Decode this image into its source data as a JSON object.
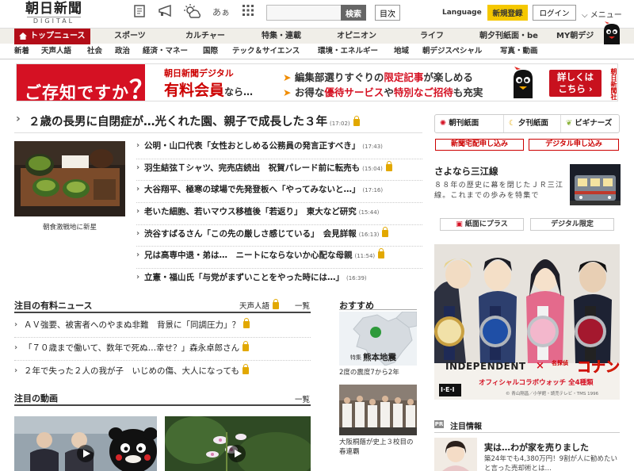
{
  "header": {
    "logo_main": "朝日新聞",
    "logo_sub": "DIGITAL",
    "search_placeholder": "",
    "search_button": "検索",
    "index_button": "目次",
    "language": "Language",
    "signup": "新規登録",
    "login": "ログイン",
    "menu": "メニュー",
    "font_size_glyph": "あぁ"
  },
  "nav_main": [
    "トップニュース",
    "スポーツ",
    "カルチャー",
    "特集・連載",
    "オピニオン",
    "ライフ",
    "朝夕刊紙面・be",
    "MY朝デジ"
  ],
  "nav_sub": [
    "新着",
    "天声人語",
    "社会",
    "政治",
    "経済・マネー",
    "国際",
    "テック＆サイエンス",
    "環境・エネルギー",
    "地域",
    "朝デジスペシャル",
    "写真・動画"
  ],
  "banner": {
    "left_text": "ご存知ですか",
    "question_mark": "？",
    "line1": "朝日新聞デジタル",
    "line2": "有料会員",
    "line2_suffix": "なら…",
    "bullet1_a": "編集部選りすぐりの",
    "bullet1_hl": "限定記事",
    "bullet1_b": "が楽しめる",
    "bullet2_a": "お得な",
    "bullet2_hl1": "優待サービス",
    "bullet2_b": "や",
    "bullet2_hl2": "特別なご招待",
    "bullet2_c": "も充実",
    "button_line1": "詳しくは",
    "button_line2": "こちら",
    "seal": "朝日新聞社"
  },
  "lead": {
    "title": "２歳の長男に自閉症が…光くれた園、親子で成長した３年",
    "time": "(17:02)"
  },
  "food_photo_caption": "朝食激戦地に新星",
  "headlines": [
    {
      "text": "公明・山口代表「女性おとしめる公務員の発言正すべき」",
      "time": "(17:43)",
      "locked": false
    },
    {
      "text": "羽生結弦Ｔシャツ、完売店続出　祝賀パレード前に転売も",
      "time": "(15:04)",
      "locked": true
    },
    {
      "text": "大谷翔平、極寒の球場で先発登板へ「やってみないと…」",
      "time": "(17:16)",
      "locked": false
    },
    {
      "text": "老いた細胞、若いマウス移植後「若返り」　東大など研究",
      "time": "(15:44)",
      "locked": false
    },
    {
      "text": "渋谷すばるさん「この先の厳しさ感じている」　会見詳報",
      "time": "(16:13)",
      "locked": true
    },
    {
      "text": "兄は高専中退・弟は…　ニートにならないか心配な母親",
      "time": "(11:54)",
      "locked": true
    },
    {
      "text": "立憲・福山氏「与党がまずいことをやった時には…」",
      "time": "(16:39)",
      "locked": false
    }
  ],
  "paid_news": {
    "title": "注目の有料ニュース",
    "tensei": "天声人語",
    "list_link": "一覧",
    "items": [
      {
        "text": "ＡＶ強要、被害者へのやまぬ非難　背景に「同調圧力」？",
        "locked": true
      },
      {
        "text": "「７０歳まで働いて、数年で死ぬ…幸せ？」森永卓郎さん",
        "locked": true
      },
      {
        "text": "２年で失った２人の我が子　いじめの傷、大人になっても",
        "locked": true
      }
    ]
  },
  "videos": {
    "title": "注目の動画",
    "list_link": "一覧"
  },
  "recommended": {
    "title": "おすすめ",
    "map_tag": "特集",
    "map_title": "熊本地震",
    "map_caption": "2度の震度7から2年",
    "photo_caption": "大阪桐蔭が史上３校目の春連覇"
  },
  "right": {
    "morning": "朝刊紙面",
    "evening": "夕刊紙面",
    "beginners": "ビギナーズ",
    "delivery_btn": "新聞宅配申し込み",
    "digital_btn": "デジタル申し込み",
    "train_title": "さよなら三江線",
    "train_body": "８８年の歴史に幕を閉じたＪＲ三江線。これまでの歩みを特集で",
    "plus_btn": "紙面にプラス",
    "limited_btn": "デジタル限定",
    "ad_brand": "INDEPENDENT",
    "ad_x": "×",
    "ad_title": "コナン",
    "ad_title_small": "名探偵",
    "ad_subtitle": "オフィシャルコラボウォッチ 全4種類",
    "ad_logo": "I·E·I",
    "ad_copyright": "© 青山剛昌／小学館・読売テレビ・TMS 1996",
    "pr": "PR",
    "attn_title": "注目情報",
    "house_title": "実は…わが家を売りました",
    "house_body": "築24年でも4,380万円！9割が人に勧めたいと言った売却術とは…"
  },
  "colors": {
    "brand_red": "#b30d18",
    "lock_gold": "#e2a800",
    "banner_red": "#d51123",
    "signup_yellow": "#f5c800"
  }
}
